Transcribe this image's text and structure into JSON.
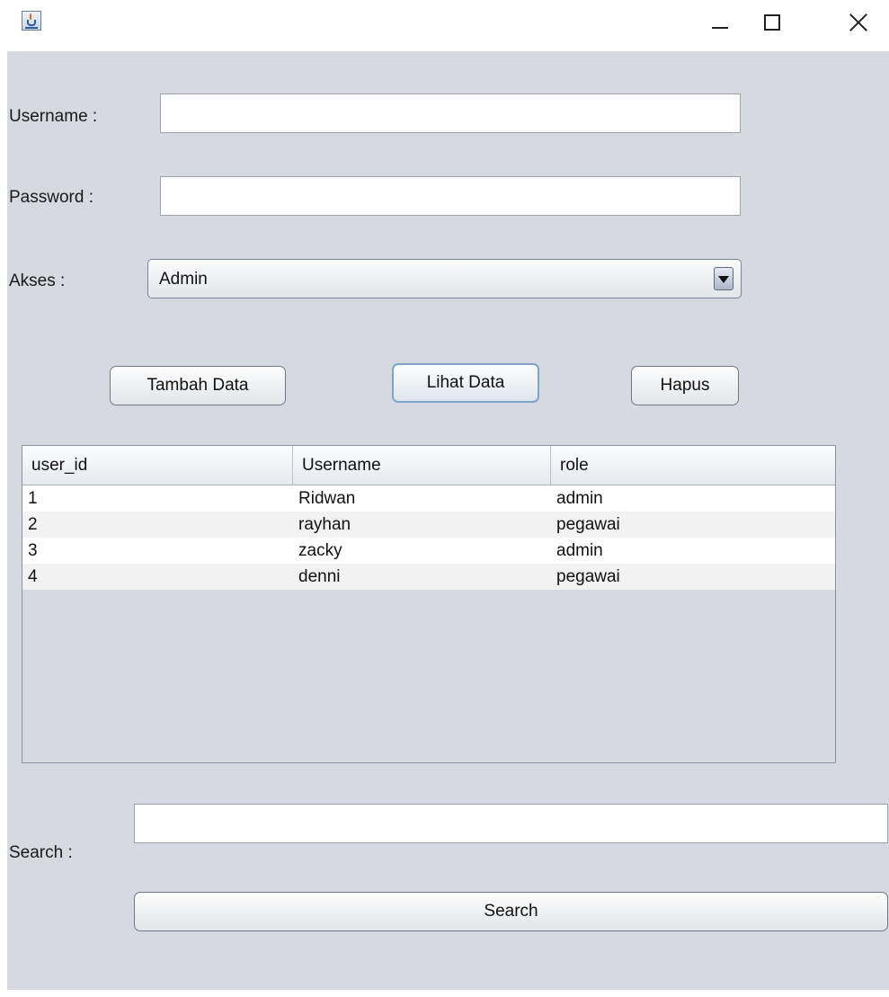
{
  "window": {
    "title": "",
    "controls": {
      "minimize": "minimize-icon",
      "maximize": "maximize-icon",
      "close": "close-icon"
    }
  },
  "form": {
    "username_label": "Username :",
    "username_value": "",
    "password_label": "Password :",
    "password_value": "",
    "akses_label": "Akses :",
    "akses_selected": "Admin"
  },
  "buttons": {
    "tambah": "Tambah Data",
    "lihat": "Lihat Data",
    "hapus": "Hapus"
  },
  "table": {
    "columns": [
      "user_id",
      "Username",
      "role"
    ],
    "rows": [
      [
        "1",
        "Ridwan",
        "admin"
      ],
      [
        "2",
        "rayhan",
        "pegawai"
      ],
      [
        "3",
        "zacky",
        "admin"
      ],
      [
        "4",
        "denni",
        "pegawai"
      ]
    ]
  },
  "search": {
    "label": "Search :",
    "value": "",
    "button": "Search"
  },
  "colors": {
    "panel_bg": "#d6d9df",
    "focus_ring": "#7fa3cf"
  }
}
